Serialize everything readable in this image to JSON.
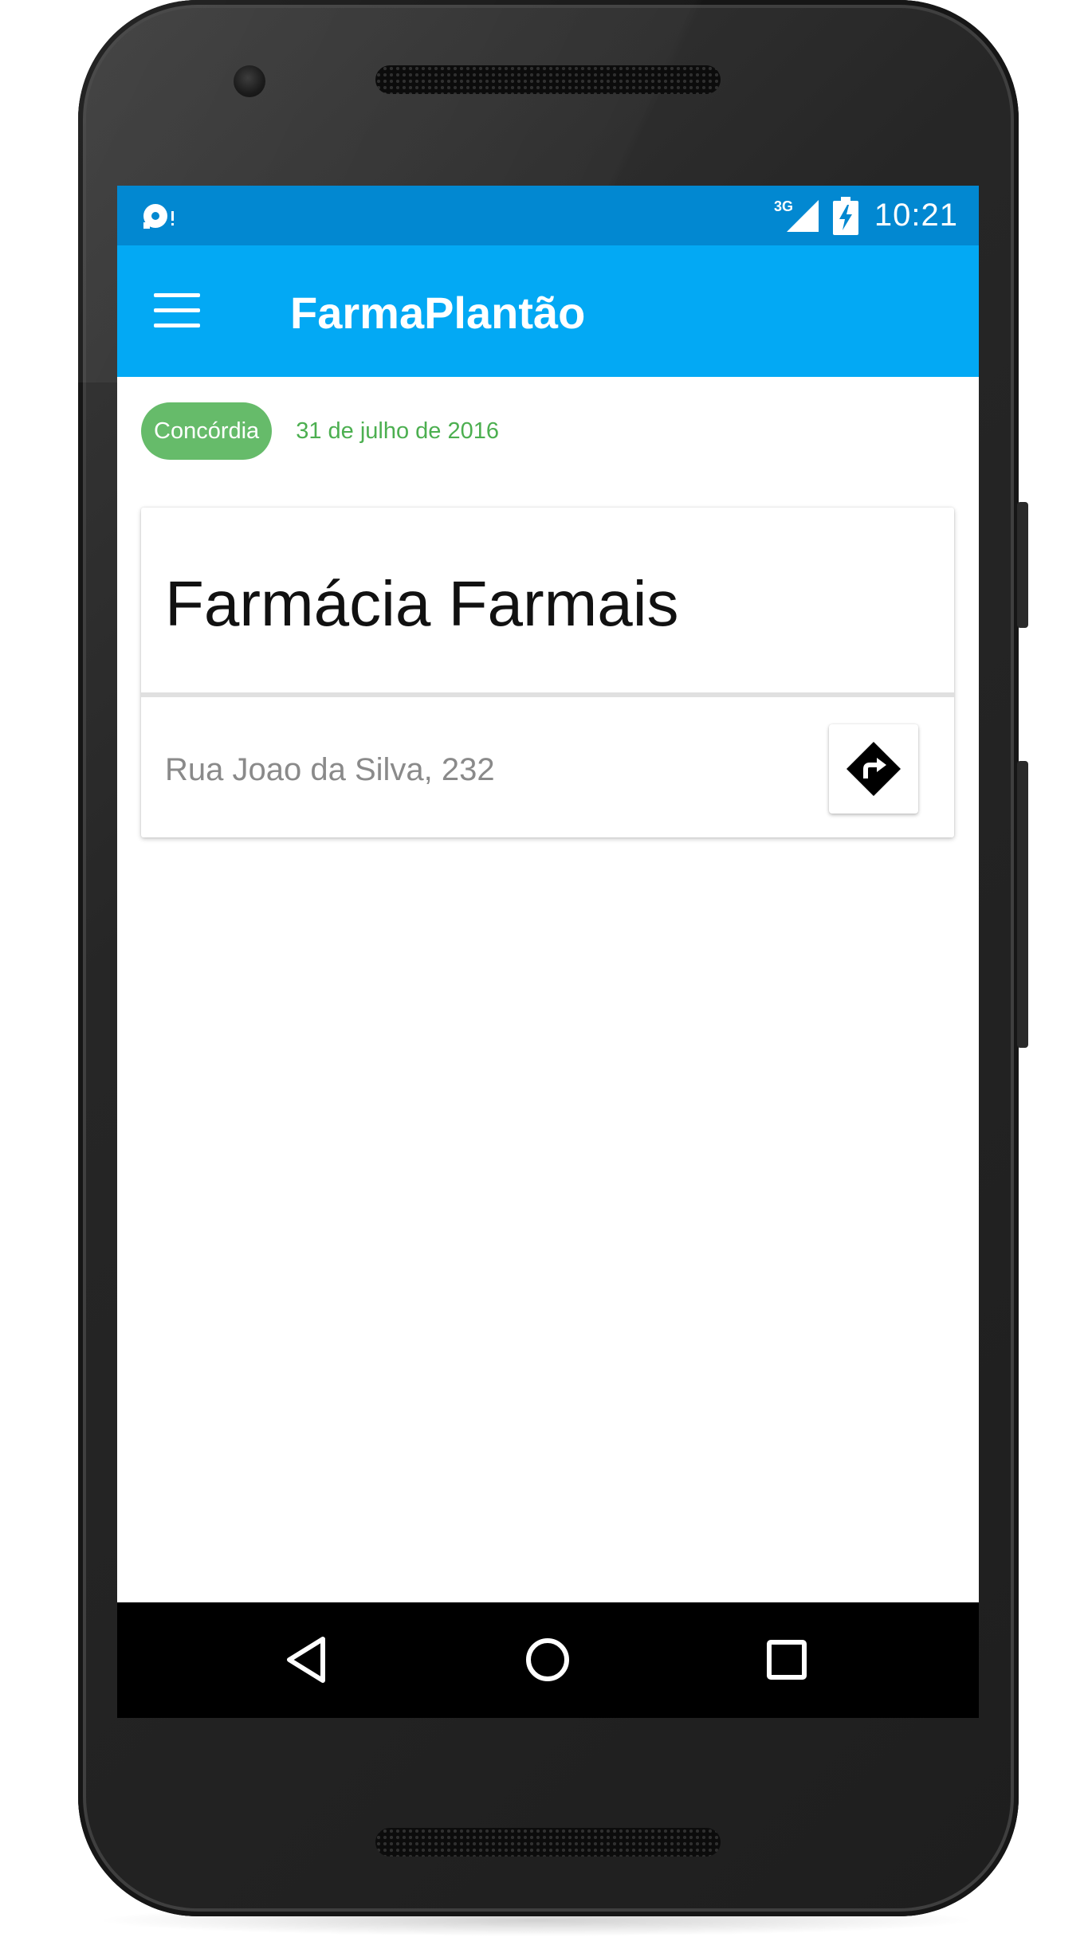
{
  "status_bar": {
    "time": "10:21",
    "network": "3G",
    "icons": [
      "notification-icon",
      "signal-3g-icon",
      "battery-charging-icon"
    ]
  },
  "app_bar": {
    "title": "FarmaPlantão",
    "menu_icon": "menu-icon"
  },
  "filter": {
    "city": "Concórdia",
    "date": "31 de julho de 2016"
  },
  "pharmacies": [
    {
      "name": "Farmácia Farmais",
      "address": "Rua Joao da Silva, 232",
      "directions_icon": "directions-icon"
    }
  ],
  "nav_bar": {
    "icons": [
      "back-icon",
      "home-icon",
      "recents-icon"
    ]
  },
  "colors": {
    "status_bar": "#0288d1",
    "app_bar": "#03a9f4",
    "chip": "#66bb6a",
    "date_text": "#4caf50"
  }
}
